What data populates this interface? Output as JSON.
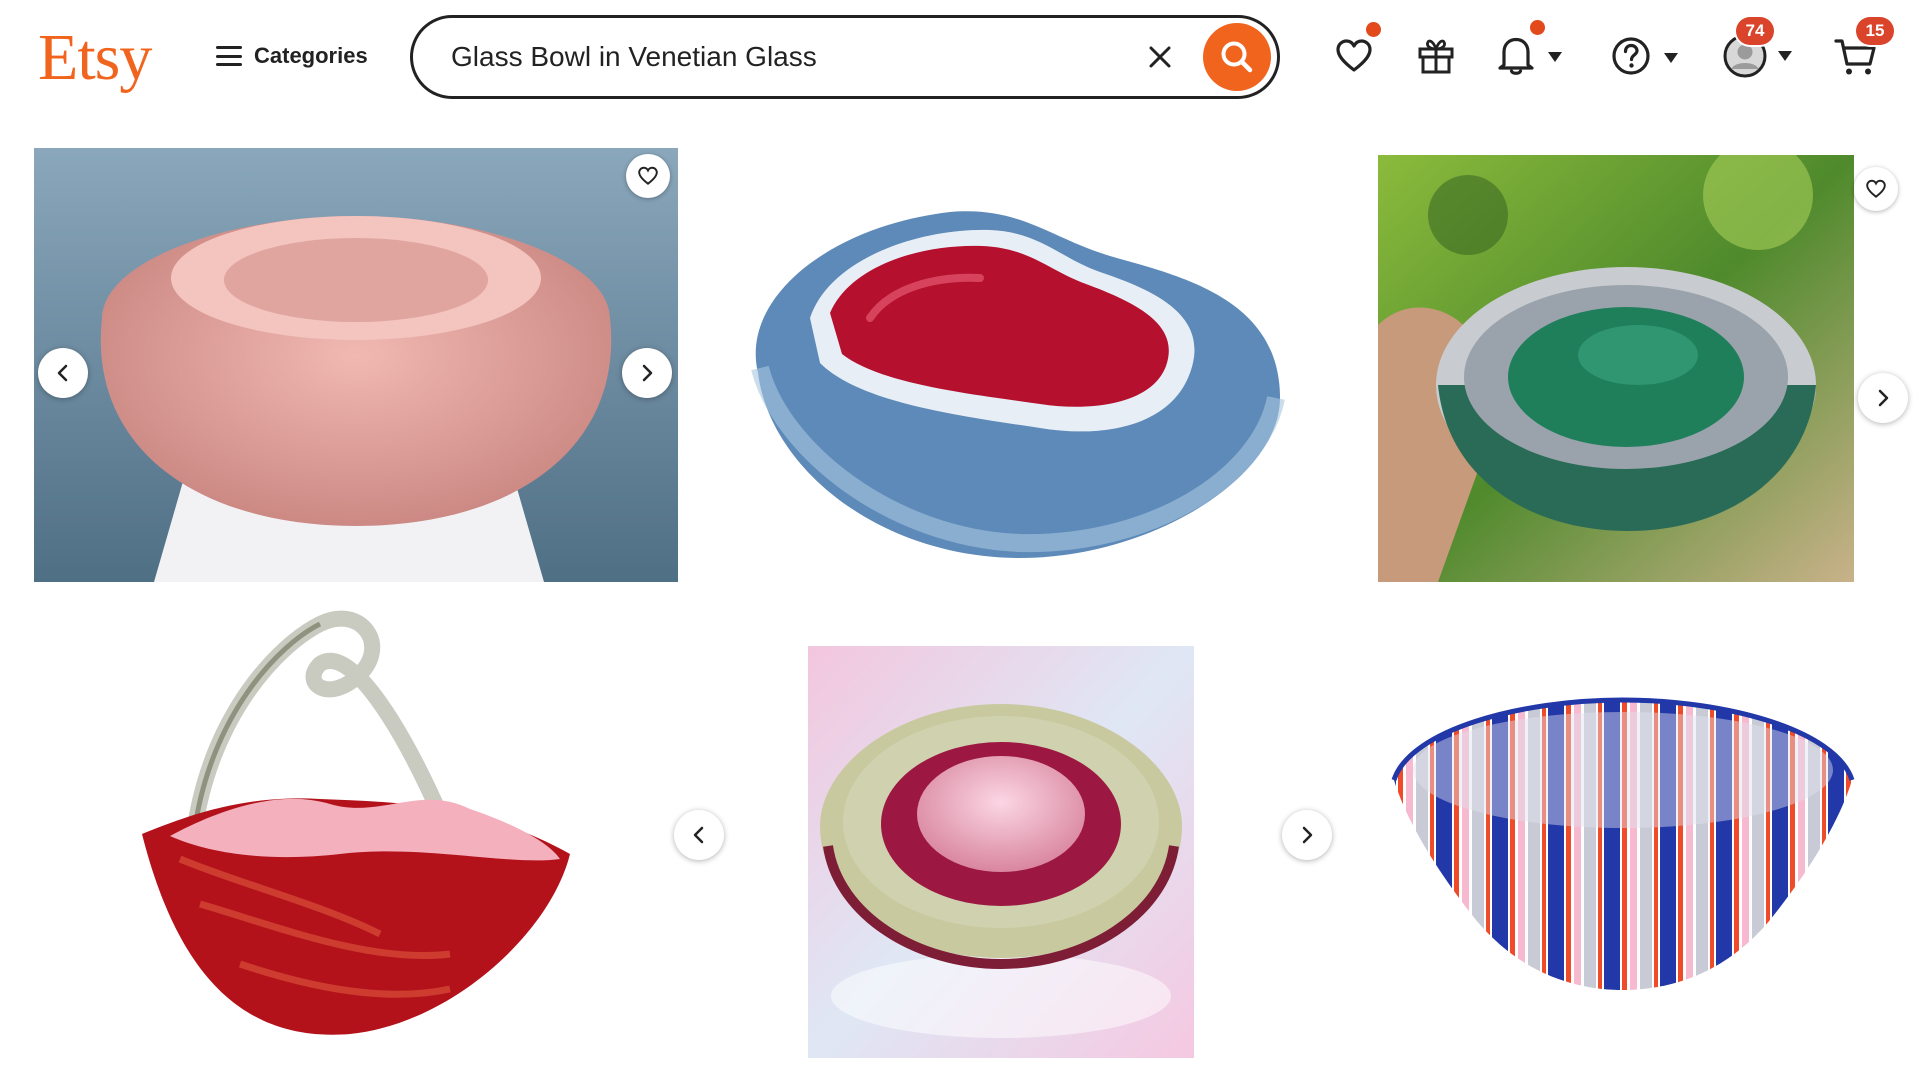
{
  "header": {
    "logo_text": "Etsy",
    "categories_label": "Categories",
    "search_value": "Glass Bowl in Venetian Glass",
    "notifications_badge": "74",
    "cart_badge": "15"
  },
  "colors": {
    "brand_orange": "#f1641e",
    "badge_red": "#d9442b",
    "text_dark": "#222222"
  },
  "icons": [
    "menu-icon",
    "close-icon",
    "search-icon",
    "heart-icon",
    "gift-icon",
    "bell-icon",
    "help-icon",
    "avatar",
    "cart-icon",
    "chevron-left-icon",
    "chevron-right-icon"
  ],
  "listings": [
    {
      "id": "pink-frosted-bowl",
      "colors": [
        "#c98a86",
        "#e8a8a3",
        "#6f8fa3"
      ]
    },
    {
      "id": "blue-red-sommerso-bowl",
      "colors": [
        "#5b86b6",
        "#b8102f",
        "#cfe0ef"
      ]
    },
    {
      "id": "green-silver-bowl",
      "colors": [
        "#3f7a2a",
        "#1f7a55",
        "#cfd2d6"
      ]
    },
    {
      "id": "red-basket",
      "colors": [
        "#b3121b",
        "#f2a6b4",
        "#c8c8c0"
      ]
    },
    {
      "id": "magenta-ashtray",
      "colors": [
        "#a11a4a",
        "#f0b6cf",
        "#d6e3f0"
      ]
    },
    {
      "id": "striped-filigrana-bowl",
      "colors": [
        "#2338a8",
        "#ef4a2a",
        "#f7b9cf"
      ]
    }
  ]
}
